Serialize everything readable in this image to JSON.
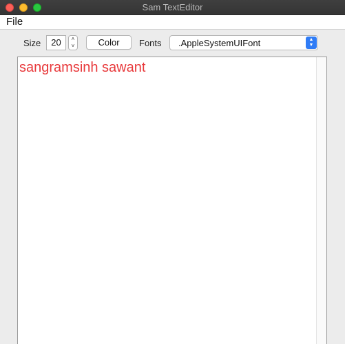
{
  "window": {
    "title": "Sam TextEditor"
  },
  "menubar": {
    "items": [
      {
        "label": "File"
      }
    ]
  },
  "toolbar": {
    "size_label": "Size",
    "size_value": "20",
    "color_button_label": "Color",
    "fonts_label": "Fonts",
    "font_selected": ".AppleSystemUIFont"
  },
  "editor": {
    "text": "sangramsinh sawant",
    "text_color": "#e8383a"
  },
  "colors": {
    "titlebar": "#3a3a3a",
    "select_accent": "#2f7cf6"
  },
  "icons": {
    "stepper_up": "chevron-up-icon",
    "stepper_down": "chevron-down-icon",
    "select_arrows": "up-down-arrows-icon"
  }
}
